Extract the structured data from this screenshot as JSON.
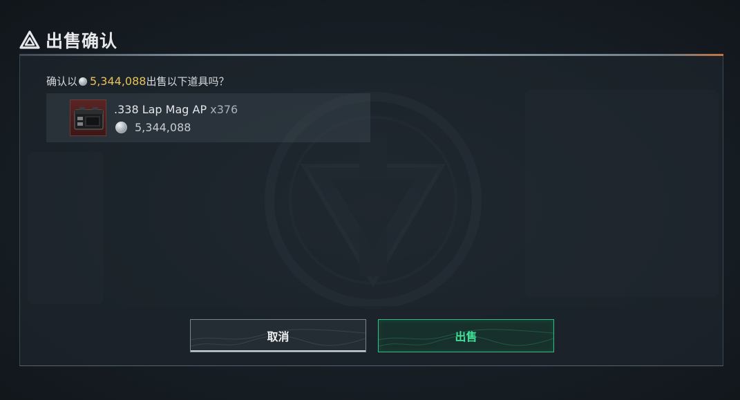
{
  "dialog": {
    "title": "出售确认",
    "question_prefix": "确认以",
    "question_amount": "5,344,088",
    "question_suffix": "出售以下道具吗？"
  },
  "item": {
    "name": ".338 Lap Mag AP",
    "quantity": "x376",
    "price": "5,344,088",
    "icon": "ammo-box-icon"
  },
  "buttons": {
    "cancel_label": "取消",
    "sell_label": "出售"
  },
  "colors": {
    "amount_gold": "#e8c25a",
    "sell_green": "#3ee39a",
    "item_rarity_red": "#5a2424"
  }
}
